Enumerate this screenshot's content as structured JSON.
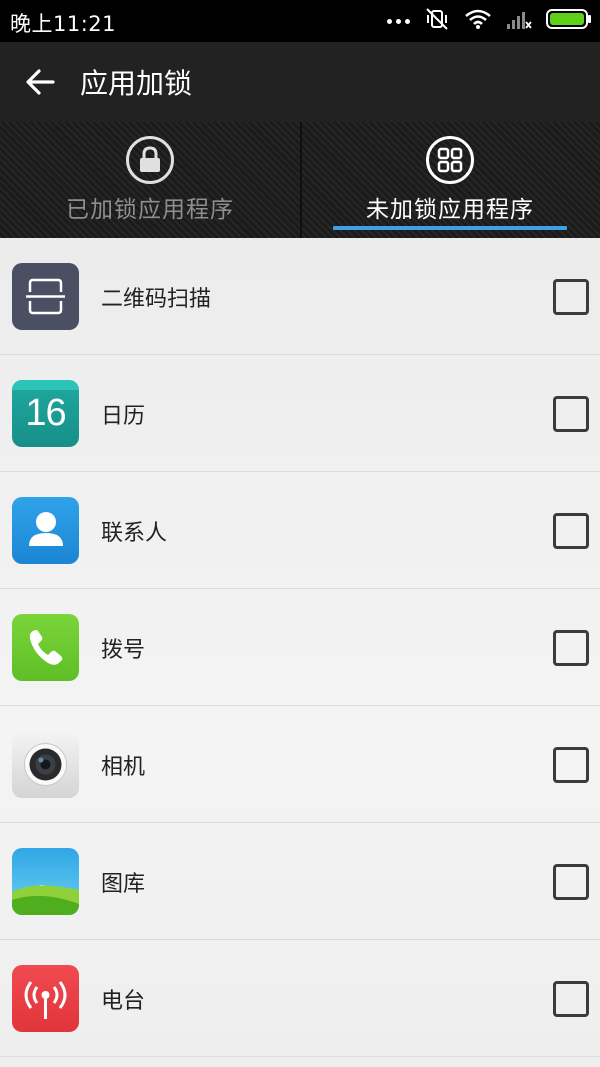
{
  "status_bar": {
    "time": "晚上11:21",
    "icons": [
      "more-dots-icon",
      "vibrate-off-icon",
      "wifi-icon",
      "signal-icon",
      "battery-icon"
    ],
    "battery_color": "#5fd018"
  },
  "app_bar": {
    "title": "应用加锁",
    "back_icon": "back-arrow-icon"
  },
  "tabs": [
    {
      "label": "已加锁应用程序",
      "icon": "lock-icon",
      "active": false
    },
    {
      "label": "未加锁应用程序",
      "icon": "grid-icon",
      "active": true
    }
  ],
  "accent_color": "#3f9fe6",
  "apps": [
    {
      "name": "二维码扫描",
      "icon": "qr-scanner-icon",
      "checked": false
    },
    {
      "name": "日历",
      "icon": "calendar-icon",
      "icon_text": "16",
      "checked": false
    },
    {
      "name": "联系人",
      "icon": "contacts-icon",
      "checked": false
    },
    {
      "name": "拨号",
      "icon": "phone-icon",
      "checked": false
    },
    {
      "name": "相机",
      "icon": "camera-icon",
      "checked": false
    },
    {
      "name": "图库",
      "icon": "gallery-icon",
      "checked": false
    },
    {
      "name": "电台",
      "icon": "radio-icon",
      "checked": false
    }
  ]
}
